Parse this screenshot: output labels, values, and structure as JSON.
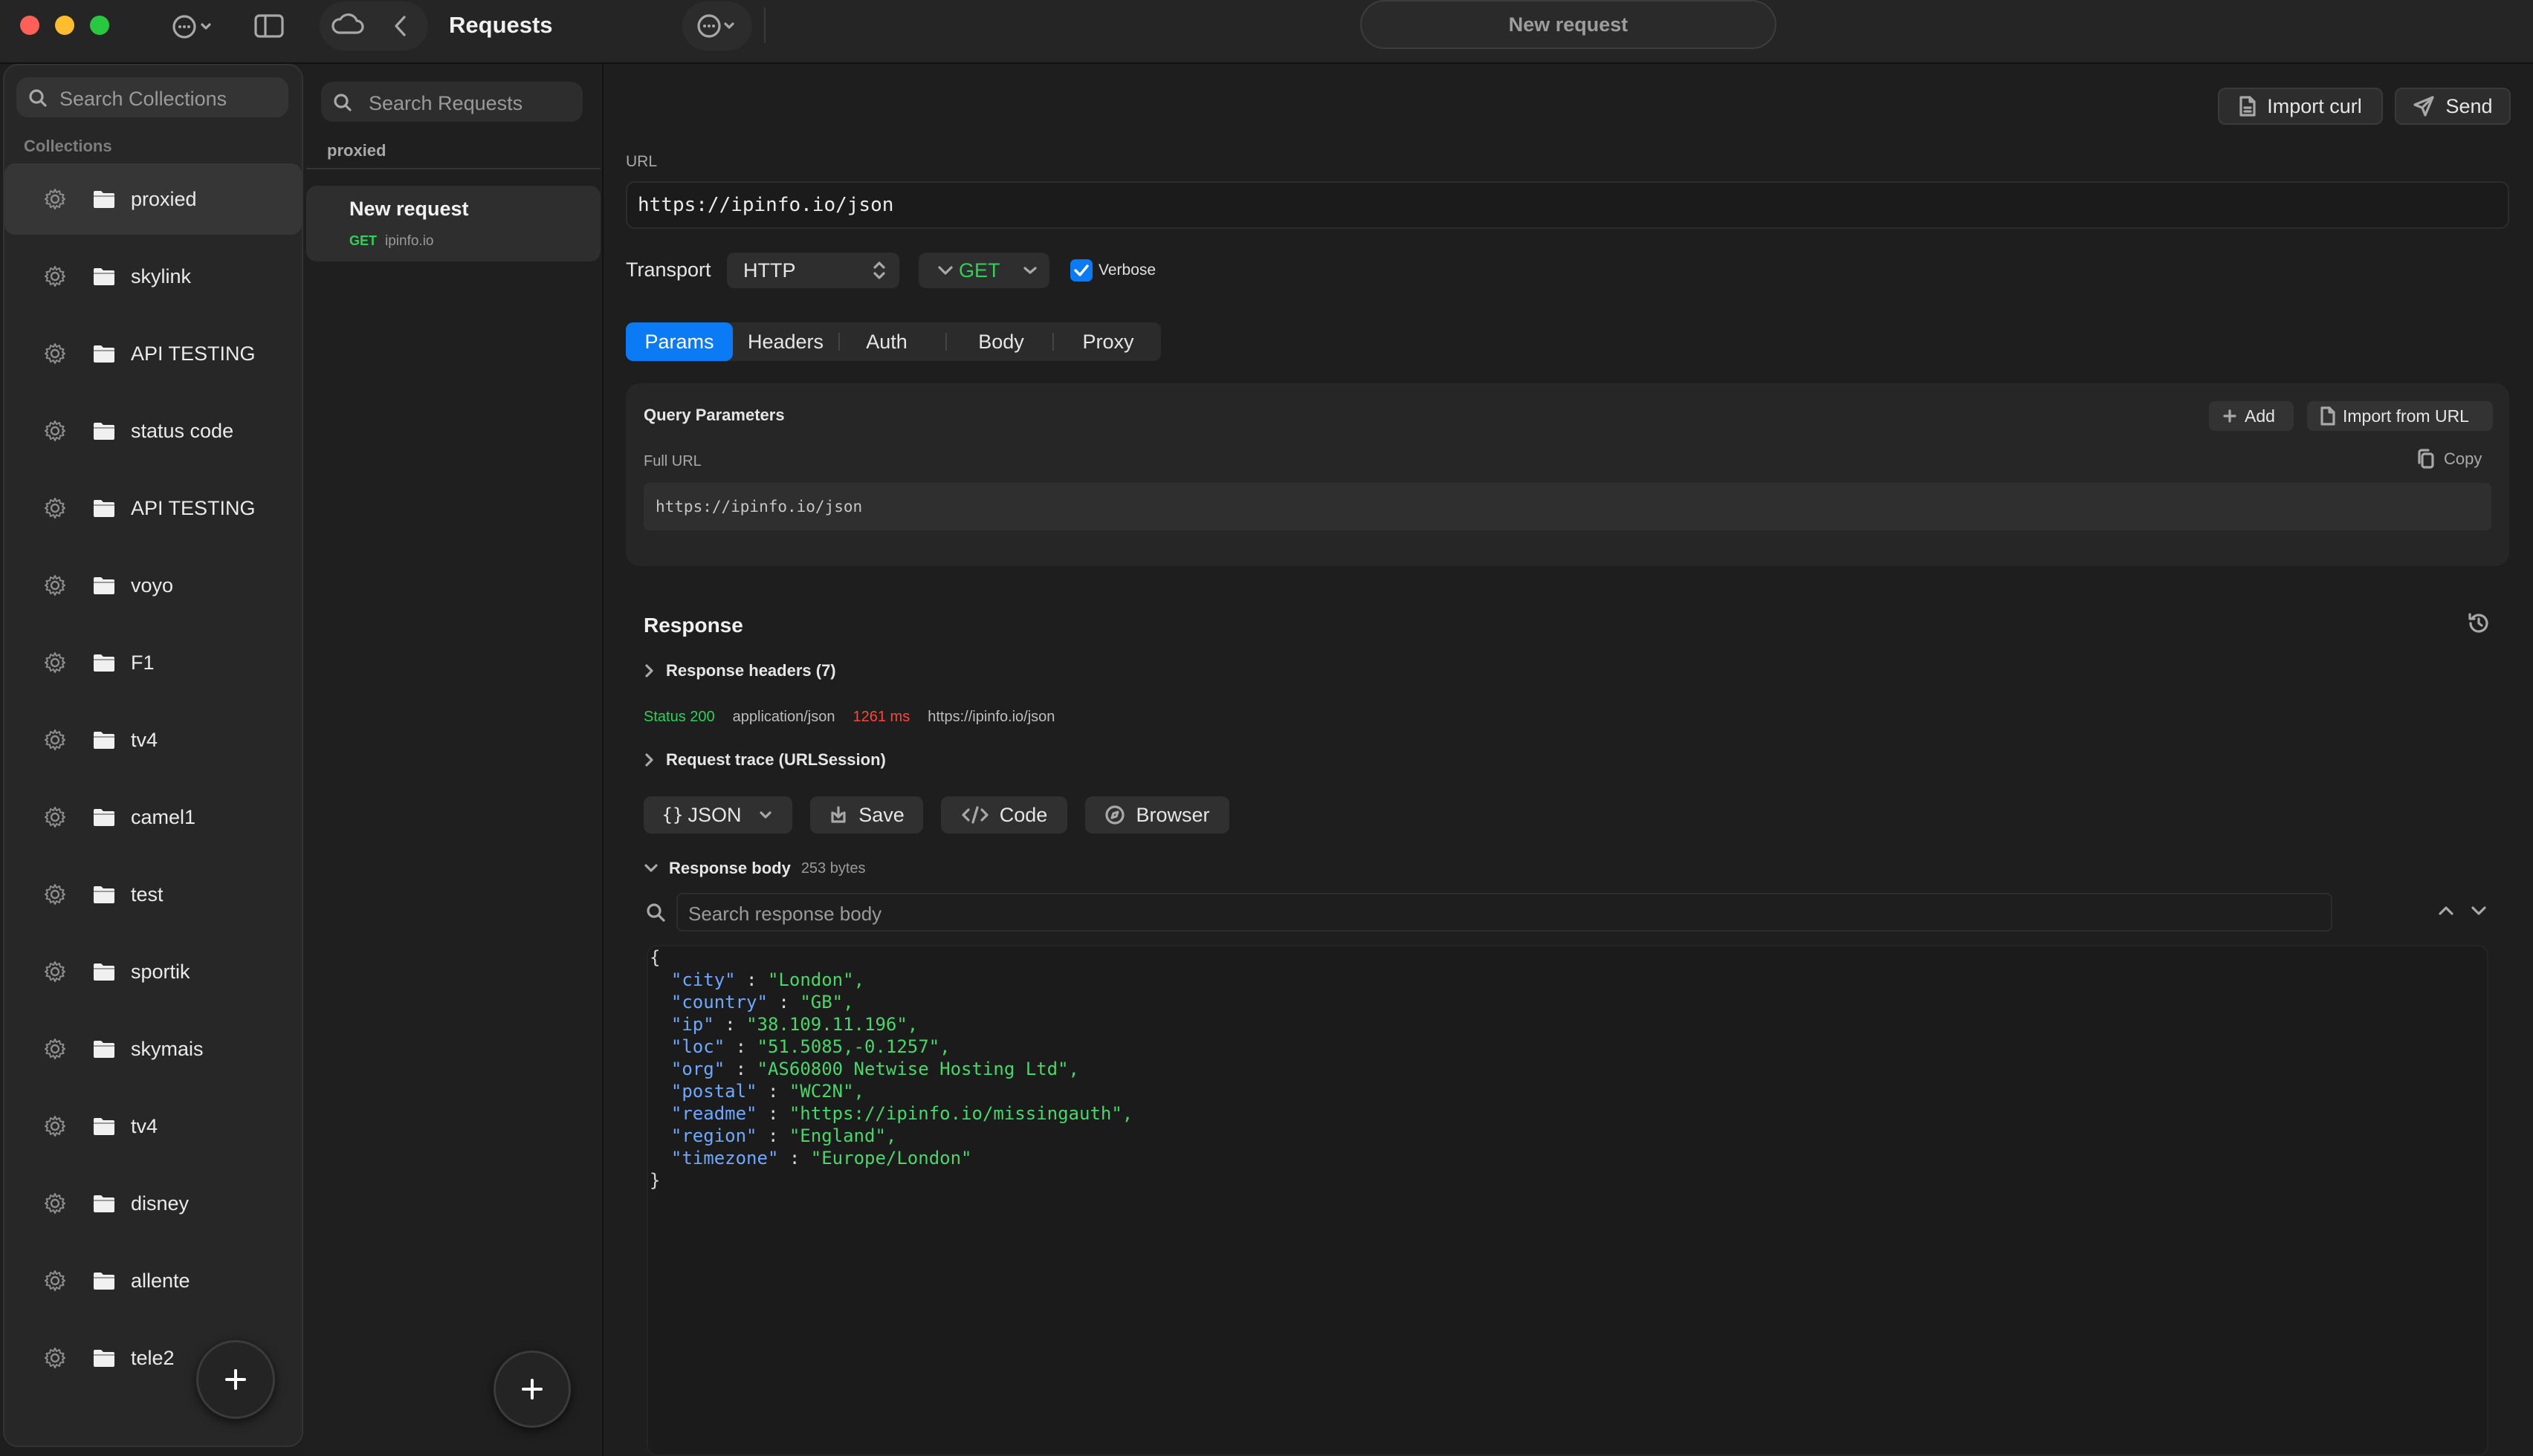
{
  "window": {
    "title": "Requests",
    "active_request_tab": "New request"
  },
  "sidebar": {
    "search_placeholder": "Search Collections",
    "section_label": "Collections",
    "collections": [
      {
        "label": "proxied"
      },
      {
        "label": "skylink"
      },
      {
        "label": "API TESTING"
      },
      {
        "label": "status code"
      },
      {
        "label": "API TESTING"
      },
      {
        "label": "voyo"
      },
      {
        "label": "F1"
      },
      {
        "label": "tv4"
      },
      {
        "label": "camel1"
      },
      {
        "label": "test"
      },
      {
        "label": "sportik"
      },
      {
        "label": "skymais"
      },
      {
        "label": "tv4"
      },
      {
        "label": "disney"
      },
      {
        "label": "allente"
      },
      {
        "label": "tele2"
      }
    ]
  },
  "requests": {
    "search_placeholder": "Search Requests",
    "group_label": "proxied",
    "items": [
      {
        "name": "New request",
        "method": "GET",
        "host": "ipinfo.io"
      }
    ]
  },
  "main": {
    "import_curl_label": "Import curl",
    "send_label": "Send",
    "url_label": "URL",
    "url_value": "https://ipinfo.io/json",
    "transport_label": "Transport",
    "transport_value": "HTTP",
    "method_value": "GET",
    "verbose_label": "Verbose",
    "verbose_checked": true,
    "tabs": [
      "Params",
      "Headers",
      "Auth",
      "Body",
      "Proxy"
    ],
    "active_tab": "Params",
    "query_params": {
      "title": "Query Parameters",
      "add_label": "Add",
      "import_label": "Import from URL",
      "full_url_label": "Full URL",
      "copy_label": "Copy",
      "full_url_value": "https://ipinfo.io/json"
    },
    "response": {
      "title": "Response",
      "headers_label": "Response headers (7)",
      "status_text": "Status 200",
      "content_type": "application/json",
      "time_text": "1261 ms",
      "response_url": "https://ipinfo.io/json",
      "trace_label": "Request trace (URLSession)",
      "format_label": "JSON",
      "save_label": "Save",
      "code_label": "Code",
      "browser_label": "Browser",
      "body_label": "Response body",
      "body_size": "253 bytes",
      "search_placeholder": "Search response body",
      "json_lines": [
        {
          "key": "",
          "value": "",
          "raw": "{"
        },
        {
          "key": "\"city\"",
          "value": "\"London\","
        },
        {
          "key": "\"country\"",
          "value": "\"GB\","
        },
        {
          "key": "\"ip\"",
          "value": "\"38.109.11.196\","
        },
        {
          "key": "\"loc\"",
          "value": "\"51.5085,-0.1257\","
        },
        {
          "key": "\"org\"",
          "value": "\"AS60800 Netwise Hosting Ltd\","
        },
        {
          "key": "\"postal\"",
          "value": "\"WC2N\","
        },
        {
          "key": "\"readme\"",
          "value": "\"https://ipinfo.io/missingauth\","
        },
        {
          "key": "\"region\"",
          "value": "\"England\","
        },
        {
          "key": "\"timezone\"",
          "value": "\"Europe/London\""
        },
        {
          "key": "",
          "value": "",
          "raw": "}"
        }
      ]
    }
  },
  "colors": {
    "accent": "#0a7bf5",
    "status_ok": "#2fd158",
    "time": "#ff453a",
    "json_key": "#6fa8ff",
    "json_value": "#49d66b"
  },
  "icons": {
    "collection_action": "gear-icon",
    "collection_type": "folder-icon"
  }
}
